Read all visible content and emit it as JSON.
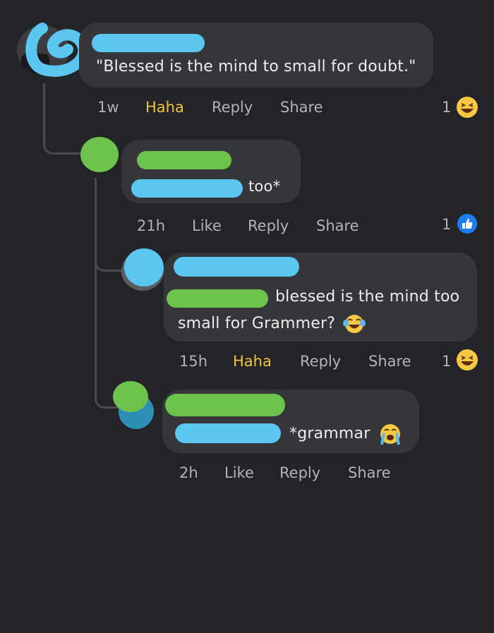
{
  "comments": [
    {
      "text": "\"Blessed is the mind to small for doubt.\"",
      "time": "1w",
      "reaction_action": "Haha",
      "reply": "Reply",
      "share": "Share",
      "reaction_count": "1",
      "reaction_icon": "laughing-emoji-icon"
    },
    {
      "text": "too*",
      "time": "21h",
      "reaction_action": "Like",
      "reply": "Reply",
      "share": "Share",
      "reaction_count": "1",
      "reaction_icon": "like-thumb-icon"
    },
    {
      "text_line1": "blessed is the mind too",
      "text_line2": "small for Grammer?",
      "time": "15h",
      "reaction_action": "Haha",
      "reply": "Reply",
      "share": "Share",
      "reaction_count": "1",
      "reaction_icon": "laughing-emoji-icon"
    },
    {
      "text": "*grammar",
      "time": "2h",
      "reaction_action": "Like",
      "reply": "Reply",
      "share": "Share"
    }
  ],
  "colors": {
    "background": "#232427",
    "bubble": "#353639",
    "haha": "#f0c43a",
    "redaction_blue": "#5bc6ef",
    "redaction_green": "#6cc24a"
  }
}
